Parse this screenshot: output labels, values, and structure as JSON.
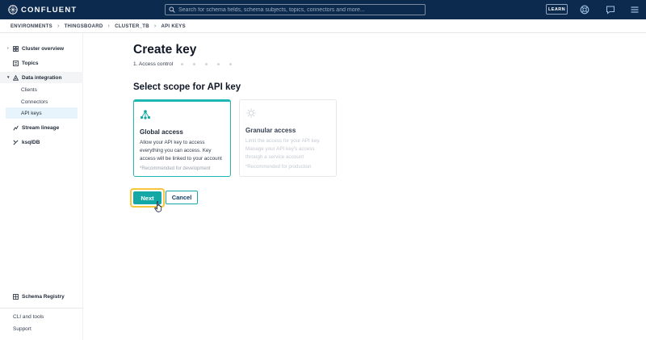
{
  "app": {
    "brand": "CONFLUENT",
    "search_placeholder": "Search for schema fields, schema subjects, topics, connectors and more...",
    "learn_label": "LEARN",
    "icons": [
      "search-icon",
      "lifebuoy-icon",
      "chat-icon",
      "menu-icon"
    ],
    "accent_color": "#13a8a5",
    "header_color": "#0c2a4e"
  },
  "breadcrumb": [
    "ENVIRONMENTS",
    "THINGSBOARD",
    "CLUSTER_TB",
    "API KEYS"
  ],
  "sidebar": {
    "items": [
      {
        "label": "Cluster overview",
        "icon": "grid-icon",
        "expandable": true
      },
      {
        "label": "Topics",
        "icon": "topics-icon",
        "expandable": false
      },
      {
        "label": "Data integration",
        "icon": "integration-icon",
        "expandable": true,
        "expanded": true
      },
      {
        "label": "Stream lineage",
        "icon": "lineage-icon",
        "expandable": false
      },
      {
        "label": "ksqlDB",
        "icon": "ksqldb-icon",
        "expandable": false
      }
    ],
    "sub_items": [
      "Clients",
      "Connectors",
      "API keys"
    ],
    "active_sub": "API keys",
    "schema_registry": "Schema Registry",
    "footer": [
      "CLI and tools",
      "Support"
    ]
  },
  "main": {
    "title": "Create key",
    "step_label": "1. Access control",
    "section_title": "Select scope for API key",
    "cards": [
      {
        "title": "Global access",
        "description": "Allow your API key to access everything you can access. Key access will be linked to your account",
        "note": "*Recommended for development",
        "selected": true
      },
      {
        "title": "Granular access",
        "description": "Limit the access for your API key. Manage your API key's access through a service account",
        "note": "*Recommended for production",
        "selected": false
      }
    ],
    "next_label": "Next",
    "cancel_label": "Cancel"
  }
}
